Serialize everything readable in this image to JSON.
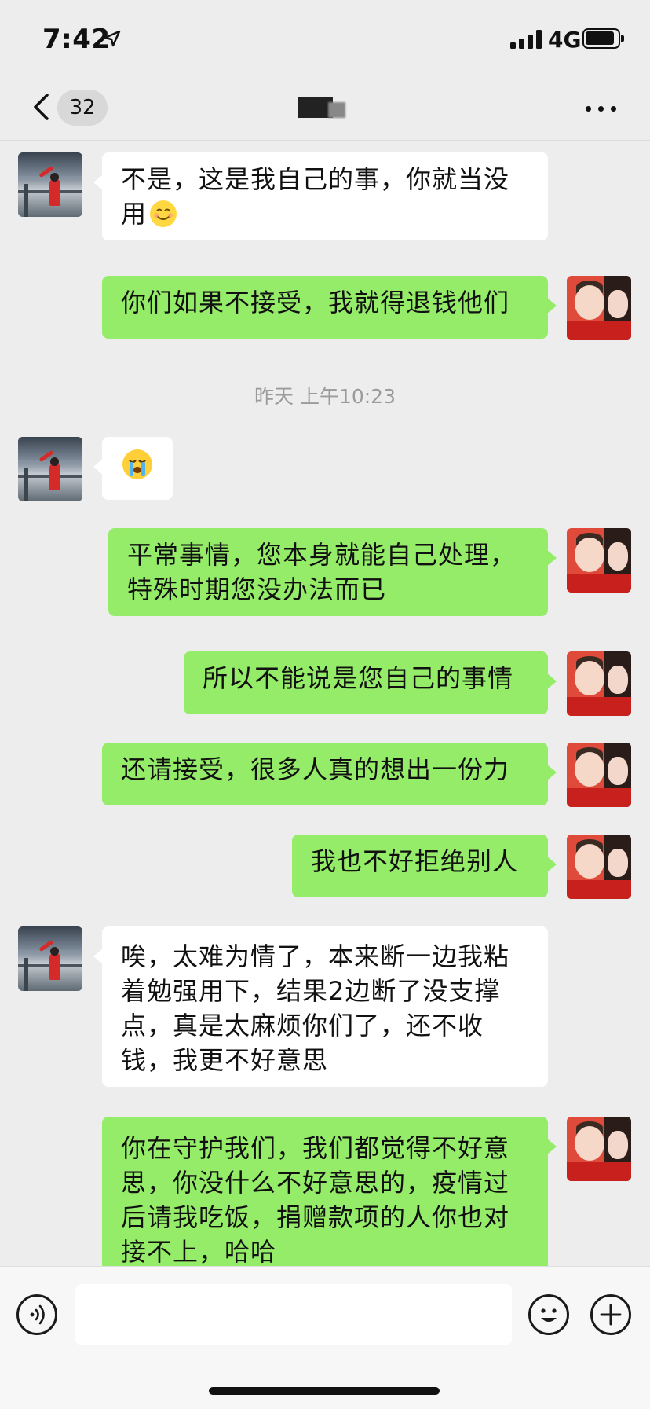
{
  "status_bar": {
    "time": "7:42",
    "network": "4G"
  },
  "nav": {
    "unread_count": "32"
  },
  "messages": [
    {
      "side": "in",
      "text": "不是，这是我自己的事，你就当没用",
      "emoji": "smile"
    },
    {
      "side": "out",
      "text": "你们如果不接受，我就得退钱他们"
    },
    {
      "side": "in",
      "text": "",
      "emoji": "cry"
    },
    {
      "side": "out",
      "text": "平常事情，您本身就能自己处理，特殊时期您没办法而已"
    },
    {
      "side": "out",
      "text": "所以不能说是您自己的事情"
    },
    {
      "side": "out",
      "text": "还请接受，很多人真的想出一份力"
    },
    {
      "side": "out",
      "text": "我也不好拒绝别人"
    },
    {
      "side": "in",
      "text": "唉，太难为情了，本来断一边我粘着勉强用下，结果2边断了没支撑点，真是太麻烦你们了，还不收钱，我更不好意思"
    },
    {
      "side": "out",
      "text": "你在守护我们，我们都觉得不好意思，你没什么不好意思的，疫情过后请我吃饭，捐赠款项的人你也对接不上，哈哈"
    }
  ],
  "timestamp": "昨天 上午10:23",
  "input": {
    "placeholder": ""
  },
  "colors": {
    "outgoing_bubble": "#95ec69",
    "incoming_bubble": "#ffffff",
    "background": "#ededed"
  }
}
